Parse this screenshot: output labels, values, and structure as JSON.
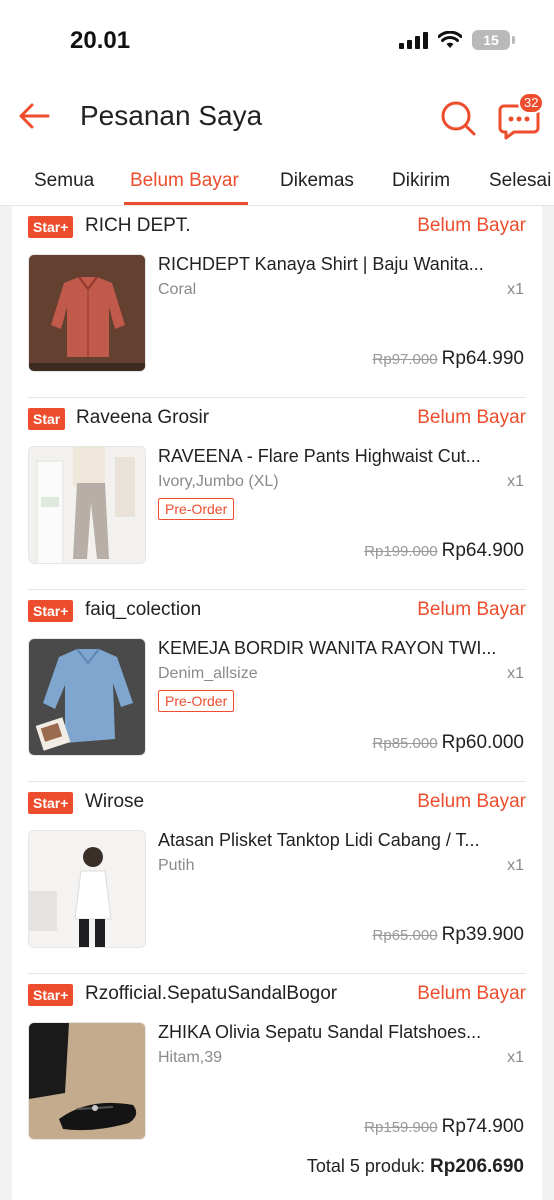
{
  "status_bar": {
    "time": "20.01",
    "battery": "15"
  },
  "header": {
    "title": "Pesanan Saya",
    "chat_badge": "32"
  },
  "tabs": [
    {
      "label": "Semua"
    },
    {
      "label": "Belum Bayar",
      "active": true
    },
    {
      "label": "Dikemas"
    },
    {
      "label": "Dikirim"
    },
    {
      "label": "Selesai"
    }
  ],
  "orders": [
    {
      "badge": "Star+",
      "shop": "RICH DEPT.",
      "status": "Belum Bayar",
      "product": "RICHDEPT Kanaya Shirt | Baju Wanita...",
      "variant": "Coral",
      "qty": "x1",
      "preorder": "",
      "old_price": "Rp97.000",
      "price": "Rp64.990",
      "image": "coral-shirt-photo"
    },
    {
      "badge": "Star",
      "shop": "Raveena Grosir",
      "status": "Belum Bayar",
      "product": "RAVEENA - Flare Pants Highwaist Cut...",
      "variant": "Ivory,Jumbo (XL)",
      "qty": "x1",
      "preorder": "Pre-Order",
      "old_price": "Rp199.000",
      "price": "Rp64.900",
      "image": "flare-pants-photo"
    },
    {
      "badge": "Star+",
      "shop": "faiq_colection",
      "status": "Belum Bayar",
      "product": "KEMEJA BORDIR WANITA RAYON TWI...",
      "variant": "Denim_allsize",
      "qty": "x1",
      "preorder": "Pre-Order",
      "old_price": "Rp85.000",
      "price": "Rp60.000",
      "image": "denim-shirt-photo"
    },
    {
      "badge": "Star+",
      "shop": "Wirose",
      "status": "Belum Bayar",
      "product": "Atasan Plisket Tanktop Lidi Cabang / T...",
      "variant": "Putih",
      "qty": "x1",
      "preorder": "",
      "old_price": "Rp65.000",
      "price": "Rp39.900",
      "image": "white-tanktop-photo"
    },
    {
      "badge": "Star+",
      "shop": "Rzofficial.SepatuSandalBogor",
      "status": "Belum Bayar",
      "product": "ZHIKA Olivia Sepatu Sandal Flatshoes...",
      "variant": "Hitam,39",
      "qty": "x1",
      "preorder": "",
      "old_price": "Rp159.900",
      "price": "Rp74.900",
      "image": "black-flatshoes-photo"
    }
  ],
  "total": {
    "label": "Total 5 produk:",
    "amount": "Rp206.690"
  },
  "colors": {
    "accent": "#ee4d2d"
  }
}
